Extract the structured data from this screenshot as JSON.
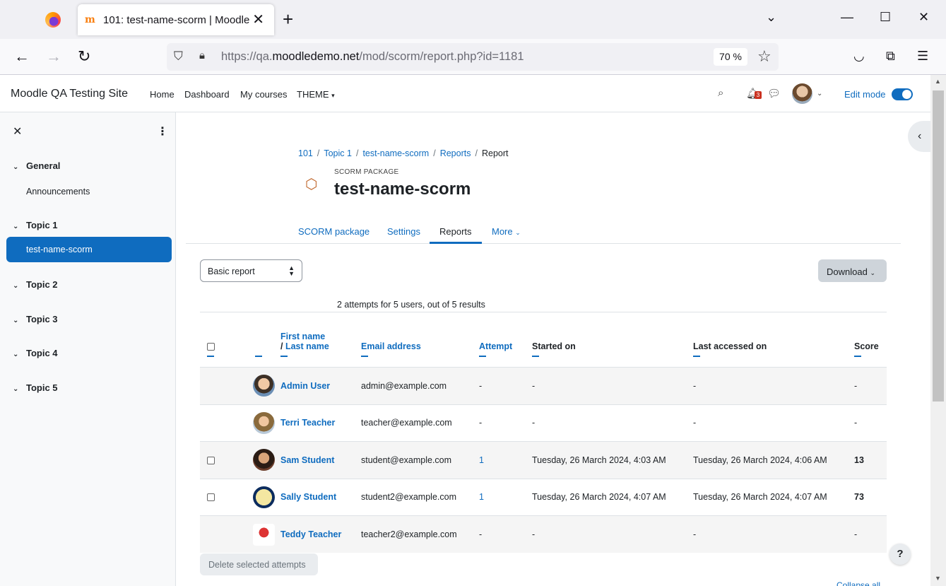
{
  "browser": {
    "tab_title": "101: test-name-scorm | Moodle",
    "url_prefix": "https://qa.",
    "url_host": "moodledemo.net",
    "url_path": "/mod/scorm/report.php?id=1181",
    "zoom": "70 %"
  },
  "header": {
    "site_name": "Moodle QA Testing Site",
    "nav": [
      "Home",
      "Dashboard",
      "My courses",
      "THEME"
    ],
    "notification_count": "3",
    "edit_mode_label": "Edit mode",
    "edit_mode_on": true,
    "accent_color": "#0f6cbf"
  },
  "drawer": {
    "sections": [
      {
        "title": "General",
        "activities": [
          "Announcements"
        ]
      },
      {
        "title": "Topic 1",
        "activities": [
          "test-name-scorm"
        ]
      },
      {
        "title": "Topic 2",
        "activities": []
      },
      {
        "title": "Topic 3",
        "activities": []
      },
      {
        "title": "Topic 4",
        "activities": []
      },
      {
        "title": "Topic 5",
        "activities": []
      }
    ],
    "active_activity": "test-name-scorm"
  },
  "page": {
    "breadcrumb": [
      "101",
      "Topic 1",
      "test-name-scorm",
      "Reports",
      "Report"
    ],
    "module_type": "SCORM PACKAGE",
    "title": "test-name-scorm",
    "secondary_nav": [
      "SCORM package",
      "Settings",
      "Reports",
      "More"
    ],
    "secondary_active": "Reports",
    "report_select": "Basic report",
    "download_label": "Download",
    "summary": "2 attempts for 5 users, out of 5 results",
    "delete_label": "Delete selected attempts",
    "collapse_all": "Collapse all"
  },
  "table": {
    "headers": {
      "first_name": "First name",
      "slash": "/",
      "last_name": "Last name",
      "email": "Email address",
      "attempt": "Attempt",
      "started": "Started on",
      "last_accessed": "Last accessed on",
      "score": "Score"
    },
    "rows": [
      {
        "name": "Admin User",
        "email": "admin@example.com",
        "attempt": "-",
        "started": "-",
        "last": "-",
        "score": "-",
        "checkbox": false
      },
      {
        "name": "Terri Teacher",
        "email": "teacher@example.com",
        "attempt": "-",
        "started": "-",
        "last": "-",
        "score": "-",
        "checkbox": false
      },
      {
        "name": "Sam Student",
        "email": "student@example.com",
        "attempt": "1",
        "started": "Tuesday, 26 March 2024, 4:03 AM",
        "last": "Tuesday, 26 March 2024, 4:06 AM",
        "score": "13",
        "checkbox": true
      },
      {
        "name": "Sally Student",
        "email": "student2@example.com",
        "attempt": "1",
        "started": "Tuesday, 26 March 2024, 4:07 AM",
        "last": "Tuesday, 26 March 2024, 4:07 AM",
        "score": "73",
        "checkbox": true
      },
      {
        "name": "Teddy Teacher",
        "email": "teacher2@example.com",
        "attempt": "-",
        "started": "-",
        "last": "-",
        "score": "-",
        "checkbox": false
      }
    ]
  },
  "icons": [
    "firefox-logo",
    "moodle-favicon",
    "back-arrow-icon",
    "forward-arrow-icon",
    "reload-icon",
    "shield-icon",
    "lock-icon",
    "star-icon",
    "pocket-icon",
    "extensions-icon",
    "menu-icon",
    "search-icon",
    "bell-icon",
    "chat-icon",
    "close-icon",
    "kebab-icon",
    "chevron-down-icon",
    "package-icon",
    "help-icon"
  ]
}
